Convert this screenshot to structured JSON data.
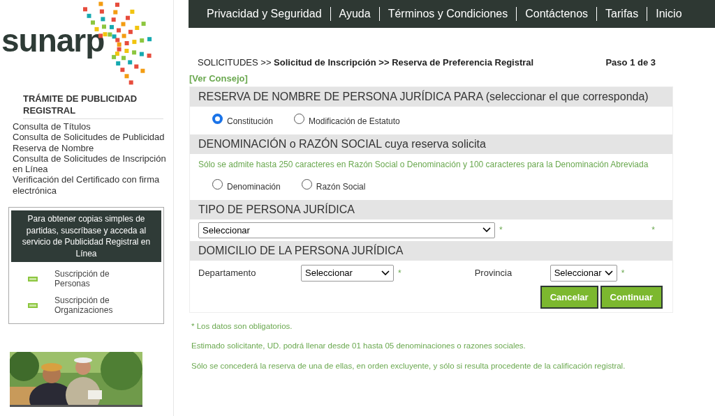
{
  "logo": {
    "text": "sunarp"
  },
  "top_nav": [
    {
      "label": "Privacidad y Seguridad"
    },
    {
      "label": "Ayuda"
    },
    {
      "label": "Términos y Condiciones"
    },
    {
      "label": "Contáctenos"
    },
    {
      "label": "Tarifas"
    },
    {
      "label": "Inicio"
    }
  ],
  "sidebar": {
    "title": "TRÁMITE DE PUBLICIDAD REGISTRAL",
    "links": [
      "Consulta de Títulos",
      "Consulta de Solicitudes de Publicidad",
      "Reserva de Nombre",
      "Consulta de Solicitudes de Inscripción en Línea",
      "Verificación del Certificado con firma electrónica"
    ],
    "promo": {
      "text": "Para obtener copias simples de partidas, suscríbase y acceda al servicio de Publicidad Registral en Línea",
      "items": [
        "Suscripción de Personas",
        "Suscripción de Organizaciones"
      ]
    },
    "banner": {
      "kind": "picture"
    }
  },
  "breadcrumb": "SOLICITUDES >> **Solicitud de Inscripción >> Reserva de Preferencia Registral**",
  "step": "Paso 1 de 3",
  "tip_link": "[Ver Consejo]",
  "sections": [
    {
      "title": "RESERVA DE NOMBRE DE PERSONA JURÍDICA PARA (seleccionar el que corresponda)",
      "kind": "radios",
      "options": [
        {
          "label": "Constitución",
          "selected": true
        },
        {
          "label": "Modificación de Estatuto",
          "selected": false
        }
      ]
    },
    {
      "title": "DENOMINACIÓN o RAZÓN SOCIAL cuya reserva solicita",
      "kind": "radios",
      "note": "Sólo se admite hasta 250 caracteres en Razón Social o Denominación y 100 caracteres para la Denominación Abreviada",
      "options": [
        {
          "label": "Denominación",
          "selected": false
        },
        {
          "label": "Razón Social",
          "selected": false
        }
      ]
    },
    {
      "title": "TIPO DE PERSONA JURÍDICA",
      "kind": "select",
      "value": "Seleccionar",
      "marks": [
        "*",
        "*"
      ]
    },
    {
      "title": "DOMICILIO DE LA PERSONA JURÍDICA",
      "kind": "fields",
      "fields": [
        {
          "label": "Departamento",
          "value": "Seleccionar",
          "mark": "*"
        },
        {
          "label": "Provincia",
          "value": "Seleccionar",
          "mark": "*"
        }
      ]
    }
  ],
  "buttons": [
    "Cancelar",
    "Continuar"
  ],
  "notes": [
    "* Los datos son obligatorios.",
    "Estimado solicitante, UD. podrá llenar desde 01 hasta 05 denominaciones o razones sociales.",
    "Sólo se concederá la reserva de una de ellas, en orden excluyente, y sólo si resulta procedente de la calificación registral."
  ]
}
